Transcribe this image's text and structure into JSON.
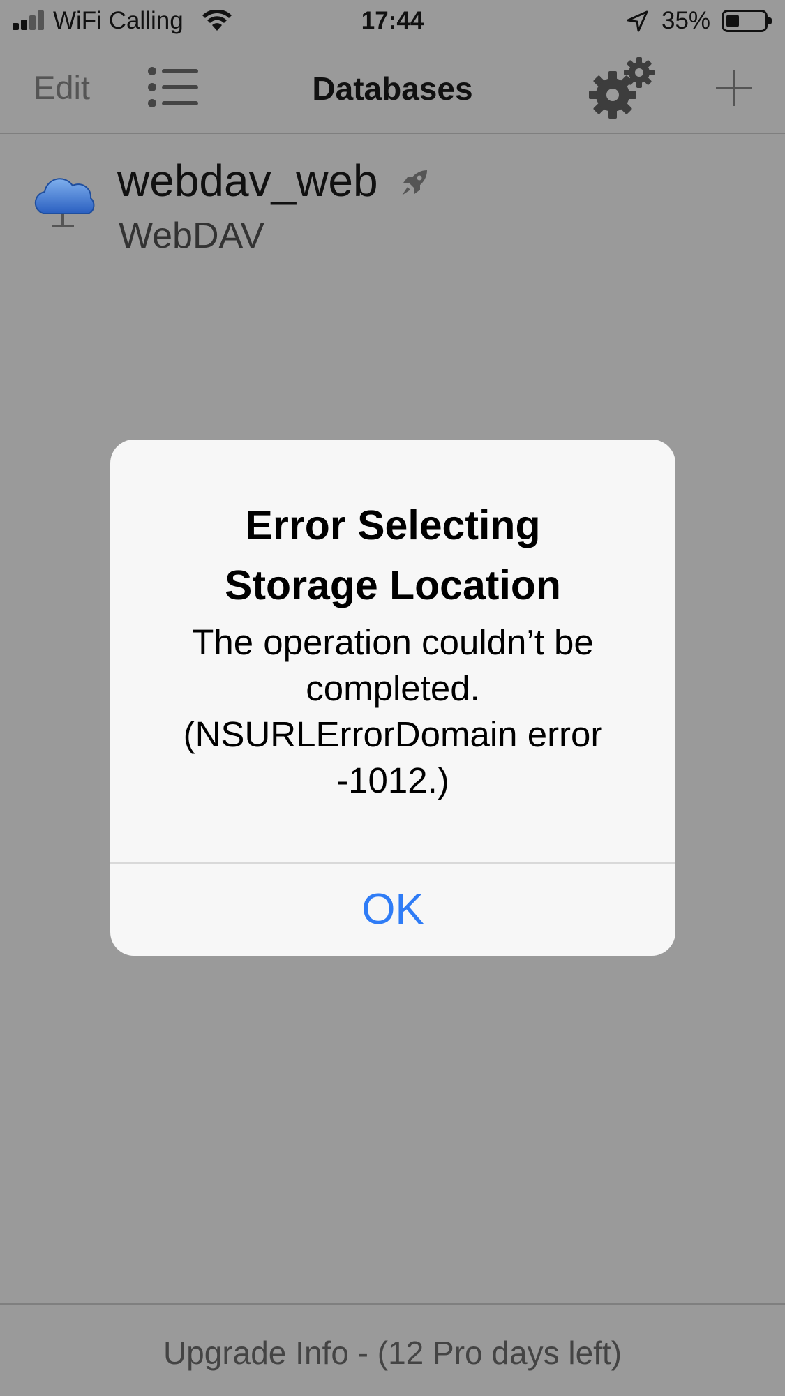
{
  "status_bar": {
    "carrier": "WiFi Calling",
    "time": "17:44",
    "battery_percent": "35%"
  },
  "nav": {
    "edit_label": "Edit",
    "title": "Databases",
    "icons": [
      "list-icon",
      "gear-icon",
      "plus-icon"
    ]
  },
  "databases": [
    {
      "name": "webdav_web",
      "type": "WebDAV",
      "icon": "cloud-icon",
      "badge_icon": "rocket-icon"
    }
  ],
  "alert": {
    "title_line1": "Error Selecting",
    "title_line2": "Storage Location",
    "message_line1": "The operation couldn’t be",
    "message_line2": "completed.",
    "message_line3": "(NSURLErrorDomain error",
    "message_line4": "-1012.)",
    "ok_label": "OK"
  },
  "footer": {
    "upgrade_text": "Upgrade Info - (12 Pro days left)"
  },
  "colors": {
    "accent": "#2f7cf6",
    "dim_background": "#9a9a9a",
    "alert_background": "#f7f7f7"
  }
}
